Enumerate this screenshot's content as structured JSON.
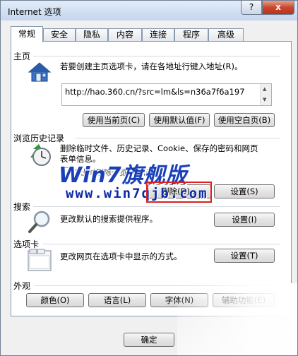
{
  "window": {
    "title": "Internet 选项",
    "help_label": "?",
    "close_label": "x"
  },
  "tabs": [
    {
      "label": "常规"
    },
    {
      "label": "安全"
    },
    {
      "label": "隐私"
    },
    {
      "label": "内容"
    },
    {
      "label": "连接"
    },
    {
      "label": "程序"
    },
    {
      "label": "高级"
    }
  ],
  "homepage": {
    "title": "主页",
    "description": "若要创建主页选项卡，请在各地址行键入地址(R)。",
    "url": "http://hao.360.cn/?src=lm&ls=n36a7f6a197",
    "use_current": "使用当前页(C)",
    "use_default": "使用默认值(F)",
    "use_blank": "使用空白页(B)"
  },
  "history": {
    "title": "浏览历史记录",
    "description_line1": "删除临时文件、历史记录、Cookie、保存的密码和网页",
    "description_line2": "表单信息。",
    "checkbox_label": "退出时删除浏览历史记录",
    "delete_button": "删除(D)...",
    "settings_button": "设置(S)"
  },
  "search": {
    "title": "搜索",
    "description": "更改默认的搜索提供程序。",
    "settings_button": "设置(I)"
  },
  "tabs_section": {
    "title": "选项卡",
    "description": "更改网页在选项卡中显示的方式。",
    "settings_button": "设置(T)"
  },
  "appearance": {
    "title": "外观",
    "colors": "颜色(O)",
    "languages": "语言(L)",
    "fonts": "字体(N)",
    "accessibility": "辅助功能(E)"
  },
  "footer": {
    "ok": "确定"
  },
  "watermark": {
    "brand": "Win7旗舰版",
    "url": "www.win7qjb.com"
  }
}
